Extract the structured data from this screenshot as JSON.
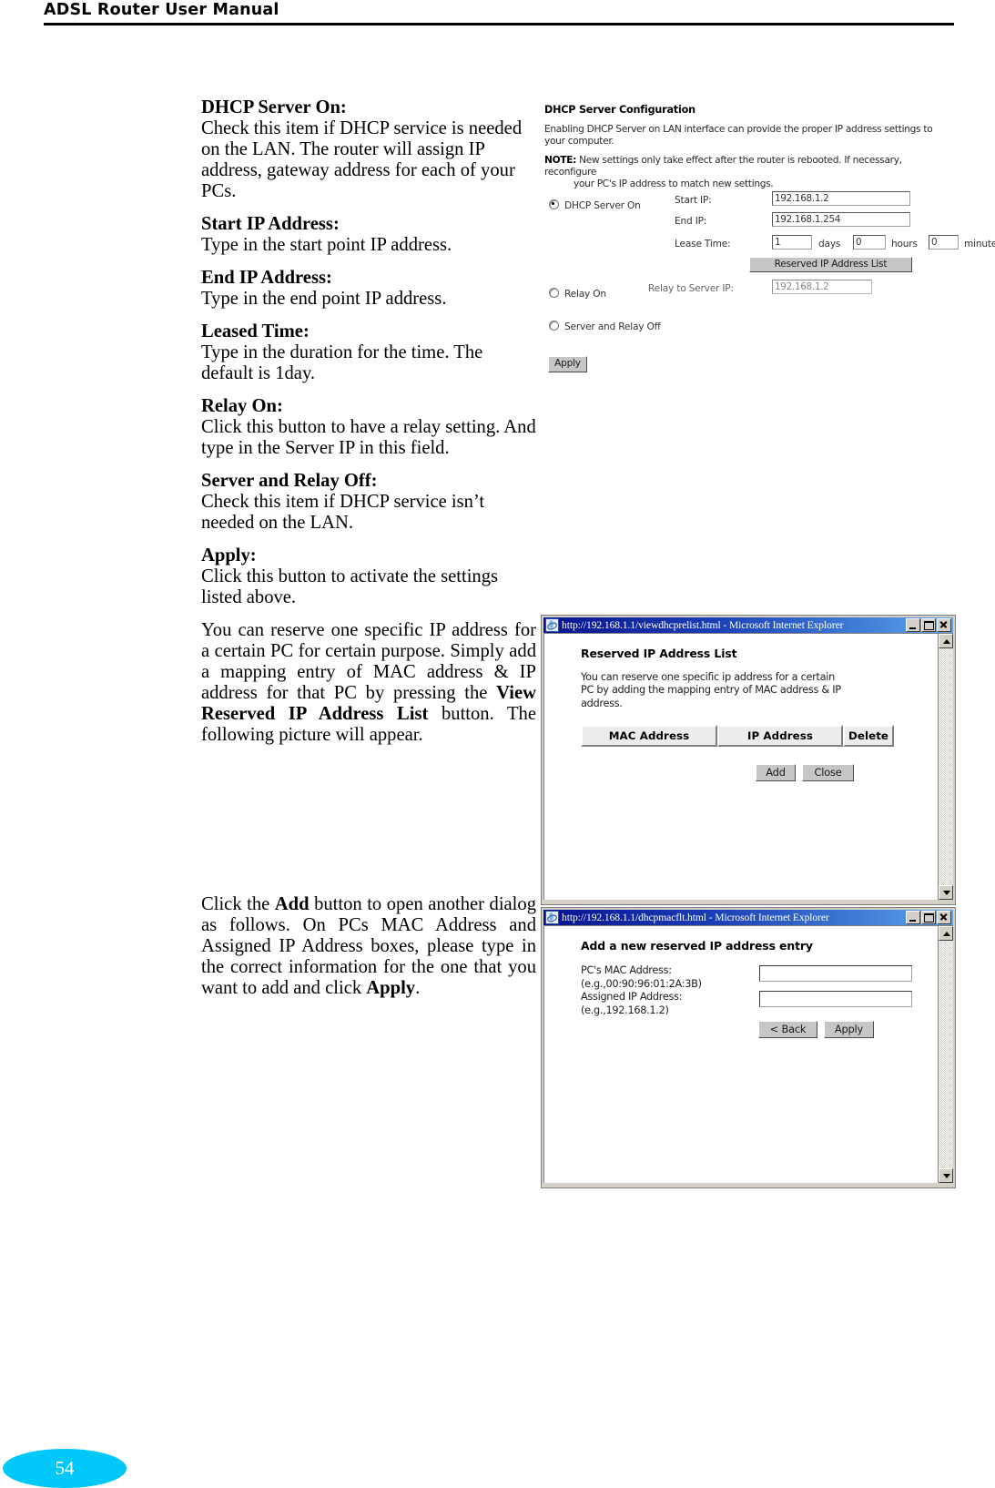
{
  "header": {
    "title": "ADSL Router User Manual"
  },
  "footer": {
    "page_number": "54",
    "badge_color": "#00c8f8"
  },
  "body_text": {
    "dhcp_server_on": {
      "lead": "DHCP Server On:",
      "text": "Check this item if DHCP service is needed on the LAN. The router will assign IP address, gateway address for each of your PCs."
    },
    "start_ip": {
      "lead": "Start IP Address:",
      "text": "Type in the start point IP address."
    },
    "end_ip": {
      "lead": "End IP Address:",
      "text": "Type in the end point IP address."
    },
    "leased_time": {
      "lead": "Leased Time:",
      "text": "Type in the duration for the time. The default is 1day."
    },
    "relay_on": {
      "lead": "Relay On:",
      "text": "Click this button to have a relay setting. And type in the Server IP in this field."
    },
    "server_relay_off": {
      "lead": "Server and Relay Off:",
      "text": "Check this item if DHCP service isn’t needed on the LAN."
    },
    "apply": {
      "lead": "Apply:",
      "text": "Click this button to activate the settings listed above."
    },
    "reserve_para": {
      "part1": "You can reserve one specific IP address for a certain PC for certain purpose. Simply add a mapping entry of MAC address & IP address for that PC by pressing the ",
      "bold1": "View Reserved IP Address List",
      "part2": " button. The following picture will appear."
    },
    "add_para": {
      "part1": "Click the ",
      "bold1": "Add",
      "part2": " button to open another dialog as follows. On PCs MAC Address and Assigned IP Address boxes, please type in the correct information for the one that you want to add and click ",
      "bold2": "Apply",
      "part3": "."
    }
  },
  "figure_dhcp": {
    "title": "DHCP Server Configuration",
    "description": "Enabling DHCP Server on LAN interface can provide the proper IP address settings to your computer.",
    "note_label": "NOTE:",
    "note_line1": " New settings only take effect after the router is rebooted. If necessary, reconfigure",
    "note_line2": "your PC's IP address to match new settings.",
    "option_server_on": "DHCP Server On",
    "option_relay_on": "Relay On",
    "option_server_relay_off": "Server and Relay Off",
    "label_start_ip": "Start IP:",
    "value_start_ip": "192.168.1.2",
    "label_end_ip": "End IP:",
    "value_end_ip": "192.168.1.254",
    "label_lease_time": "Lease Time:",
    "value_days": "1",
    "unit_days": "days",
    "value_hours": "0",
    "unit_hours": "hours",
    "value_minutes": "0",
    "unit_minutes": "minutes",
    "button_reserved_list": "Reserved IP Address List",
    "label_relay_to_server_ip": "Relay to Server IP:",
    "value_relay_server_ip": "192.168.1.2",
    "button_apply": "Apply"
  },
  "window_reserved_list": {
    "title": "http://192.168.1.1/viewdhcprelist.html - Microsoft Internet Explorer",
    "heading": "Reserved IP Address List",
    "description": "You can reserve one specific ip address for a certain PC by adding the mapping entry of MAC address & IP address.",
    "columns": [
      "MAC Address",
      "IP Address",
      "Delete"
    ],
    "rows": [],
    "button_add": "Add",
    "button_close": "Close"
  },
  "window_add_entry": {
    "title": "http://192.168.1.1/dhcpmacflt.html - Microsoft Internet Explorer",
    "heading": "Add a new reserved IP address entry",
    "field_mac_label": "PC's MAC Address:",
    "field_mac_example": "(e.g.,00:90:96:01:2A:3B)",
    "field_mac_value": "",
    "field_ip_label": "Assigned IP Address:",
    "field_ip_example": "(e.g.,192.168.1.2)",
    "field_ip_value": "",
    "button_back": "< Back",
    "button_apply": "Apply"
  }
}
